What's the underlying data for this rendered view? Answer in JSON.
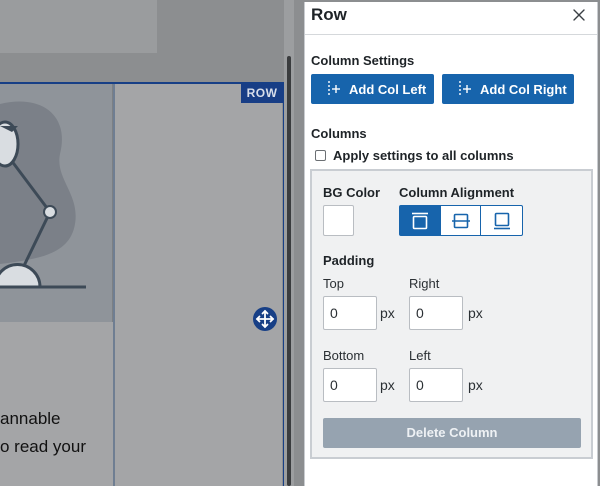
{
  "canvas": {
    "row_badge": "ROW",
    "body_text": [
      "annable",
      "o read your"
    ]
  },
  "panel": {
    "title": "Row",
    "column_settings_label": "Column Settings",
    "add_col_left": "Add Col Left",
    "add_col_right": "Add Col Right",
    "columns_label": "Columns",
    "apply_all_label": "Apply settings to all columns",
    "apply_all_checked": false,
    "bg_color_label": "BG Color",
    "bg_color_value": "#ffffff",
    "alignment_label": "Column Alignment",
    "alignment_options": [
      "align-top-icon",
      "align-middle-icon",
      "align-bottom-icon"
    ],
    "alignment_selected": "top",
    "padding_label": "Padding",
    "padding": {
      "top": {
        "label": "Top",
        "value": "0",
        "unit": "px"
      },
      "right": {
        "label": "Right",
        "value": "0",
        "unit": "px"
      },
      "bottom": {
        "label": "Bottom",
        "value": "0",
        "unit": "px"
      },
      "left": {
        "label": "Left",
        "value": "0",
        "unit": "px"
      }
    },
    "delete_label": "Delete Column"
  },
  "colors": {
    "accent": "#1764ac",
    "row_outline": "#173f86",
    "delete_disabled": "#96a3b0"
  }
}
